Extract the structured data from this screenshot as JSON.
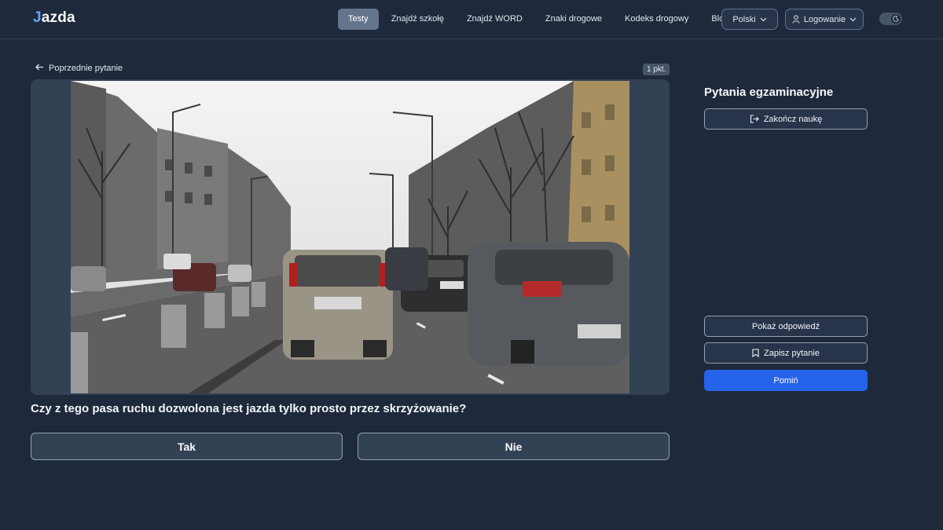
{
  "header": {
    "logo_mark": "J",
    "logo_text": "azda",
    "nav": [
      "Testy",
      "Znajdź szkołę",
      "Znajdź WORD",
      "Znaki drogowe",
      "Kodeks drogowy",
      "Blog"
    ],
    "language": "Polski",
    "login": "Logowanie"
  },
  "question": {
    "prev_label": "Poprzednie pytanie",
    "points": "1 pkt.",
    "text": "Czy z tego pasa ruchu dozwolona jest jazda tylko prosto przez skrzyżowanie?",
    "answers": [
      "Tak",
      "Nie"
    ]
  },
  "sidebar": {
    "title": "Pytania egzaminacyjne",
    "end_learning": "Zakończ naukę",
    "show_answer": "Pokaż odpowiedź",
    "save_question": "Zapisz pytanie",
    "skip": "Pomiń"
  },
  "colors": {
    "background": "#1e293b",
    "accent": "#2563eb",
    "active_nav": "#64748b"
  },
  "icons": {
    "back": "arrow-left-icon",
    "user": "user-icon",
    "theme": "moon-icon",
    "exit": "exit-icon",
    "bookmark": "bookmark-icon"
  }
}
